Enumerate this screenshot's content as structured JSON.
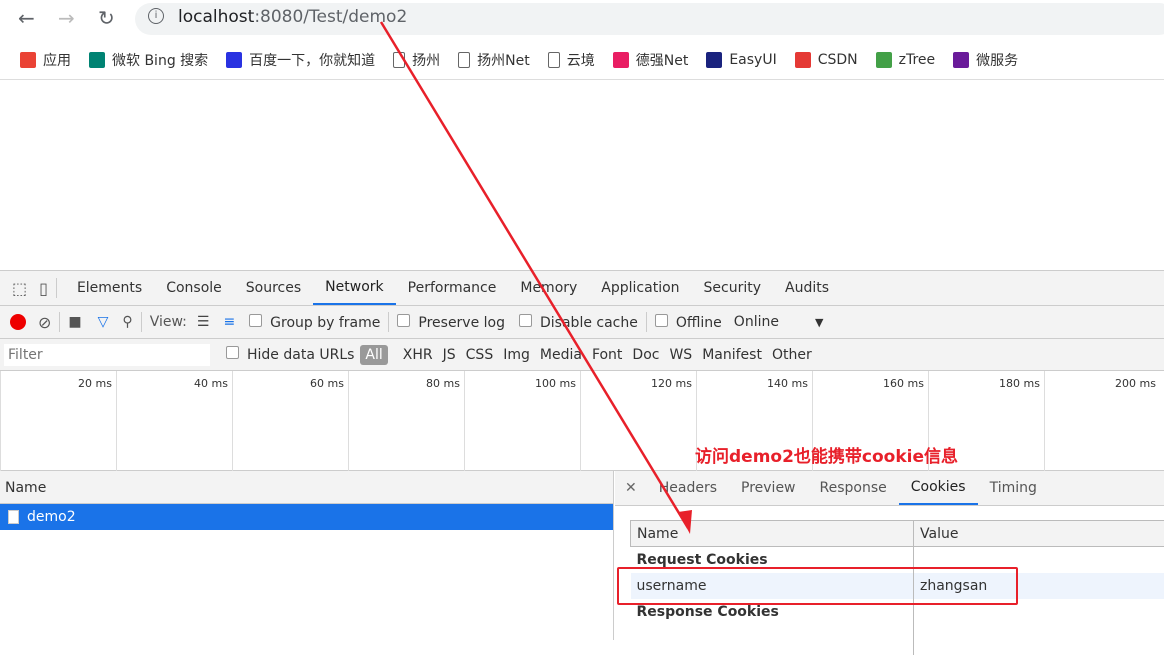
{
  "browser": {
    "url_host": "localhost",
    "url_rest": ":8080/Test/demo2",
    "bookmarks": [
      {
        "label": "应用",
        "icon": "apps-grid-icon",
        "color": "#ea4335"
      },
      {
        "label": "微软 Bing 搜索",
        "icon": "bing-icon",
        "color": "#008373"
      },
      {
        "label": "百度一下，你就知道",
        "icon": "baidu-icon",
        "color": "#2932e1"
      },
      {
        "label": "扬州",
        "icon": "page-icon",
        "color": "#777"
      },
      {
        "label": "扬州Net",
        "icon": "page-icon",
        "color": "#777"
      },
      {
        "label": "云境",
        "icon": "page-icon",
        "color": "#777"
      },
      {
        "label": "德强Net",
        "icon": "colorful-icon",
        "color": "#e91e63"
      },
      {
        "label": "EasyUI",
        "icon": "easyui-icon",
        "color": "#1a237e"
      },
      {
        "label": "CSDN",
        "icon": "csdn-icon",
        "color": "#e53935"
      },
      {
        "label": "zTree",
        "icon": "ztree-icon",
        "color": "#43a047"
      },
      {
        "label": "微服务",
        "icon": "f-icon",
        "color": "#6a1b9a"
      }
    ]
  },
  "devtools": {
    "tabs": [
      "Elements",
      "Console",
      "Sources",
      "Network",
      "Performance",
      "Memory",
      "Application",
      "Security",
      "Audits"
    ],
    "active_tab": "Network",
    "toolbar": {
      "view_label": "View:",
      "group_by_frame": "Group by frame",
      "preserve_log": "Preserve log",
      "disable_cache": "Disable cache",
      "offline": "Offline",
      "throttle": "Online"
    },
    "filter": {
      "placeholder": "Filter",
      "hide_data_urls": "Hide data URLs",
      "types": [
        "All",
        "XHR",
        "JS",
        "CSS",
        "Img",
        "Media",
        "Font",
        "Doc",
        "WS",
        "Manifest",
        "Other"
      ]
    },
    "timeline_ticks": [
      "20 ms",
      "40 ms",
      "60 ms",
      "80 ms",
      "100 ms",
      "120 ms",
      "140 ms",
      "160 ms",
      "180 ms",
      "200 ms"
    ],
    "requests": {
      "header": "Name",
      "items": [
        "demo2"
      ]
    },
    "detail": {
      "tabs": [
        "Headers",
        "Preview",
        "Response",
        "Cookies",
        "Timing"
      ],
      "active_tab": "Cookies",
      "columns": [
        "Name",
        "Value"
      ],
      "request_section": "Request Cookies",
      "cookies": [
        {
          "name": "username",
          "value": "zhangsan"
        }
      ],
      "response_section": "Response Cookies"
    }
  },
  "annotation": {
    "text": "访问demo2也能携带cookie信息",
    "color": "#e8202a"
  }
}
